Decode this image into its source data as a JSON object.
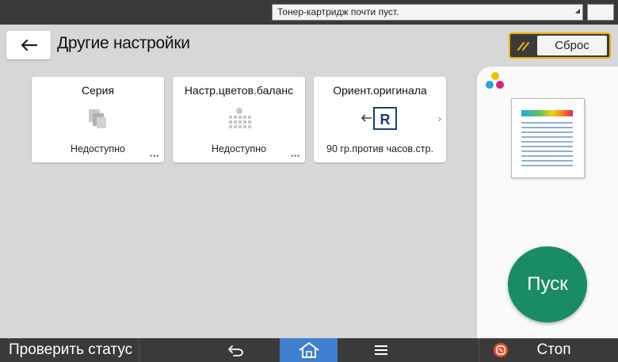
{
  "status_bar": {
    "message": "Тонер-картридж почти пуст.",
    "moon_icon": "moon-icon"
  },
  "header": {
    "title": "Другие настройки",
    "reset_label": "Сброс"
  },
  "settings": [
    {
      "title": "Серия",
      "value": "Недоступно",
      "icon": "series-icon"
    },
    {
      "title": "Настр.цветов.баланс",
      "value": "Недоступно",
      "icon": "color-balance-icon"
    },
    {
      "title": "Ориент.оригинала",
      "value": "90 гр.против часов.стр.",
      "icon": "orientation-icon"
    }
  ],
  "start_label": "Пуск",
  "bottom_bar": {
    "status_label": "Проверить статус",
    "stop_label": "Стоп"
  },
  "colors": {
    "start": "#1a8c63",
    "home_active": "#3f7fd0",
    "reset_border": "#f0b000"
  }
}
